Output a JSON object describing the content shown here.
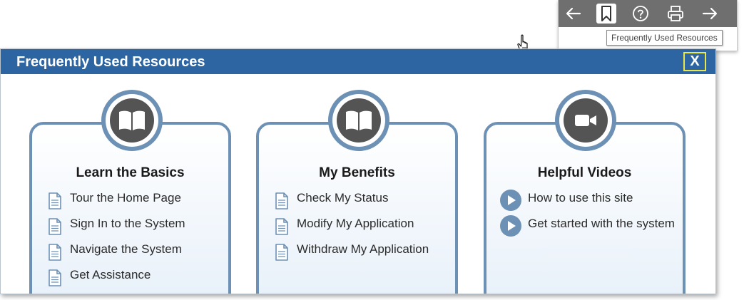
{
  "toolbar": {
    "tooltip": "Frequently Used Resources",
    "icons": [
      "arrow-left-icon",
      "bookmark-icon",
      "help-icon",
      "print-icon",
      "arrow-right-icon"
    ]
  },
  "dialog": {
    "title": "Frequently Used Resources",
    "close_label": "X",
    "accent_color": "#2d65a3",
    "card_border_color": "#6d90b5",
    "cards": [
      {
        "title": "Learn the Basics",
        "icon": "book-icon",
        "links": [
          "Tour the Home Page",
          "Sign In to the System",
          "Navigate the System",
          "Get Assistance"
        ]
      },
      {
        "title": "My Benefits",
        "icon": "book-icon",
        "links": [
          "Check My Status",
          "Modify My Application",
          "Withdraw My Application"
        ]
      },
      {
        "title": "Helpful Videos",
        "icon": "video-camera-icon",
        "links": [
          "How to use this site",
          "Get started with the system"
        ]
      }
    ]
  }
}
